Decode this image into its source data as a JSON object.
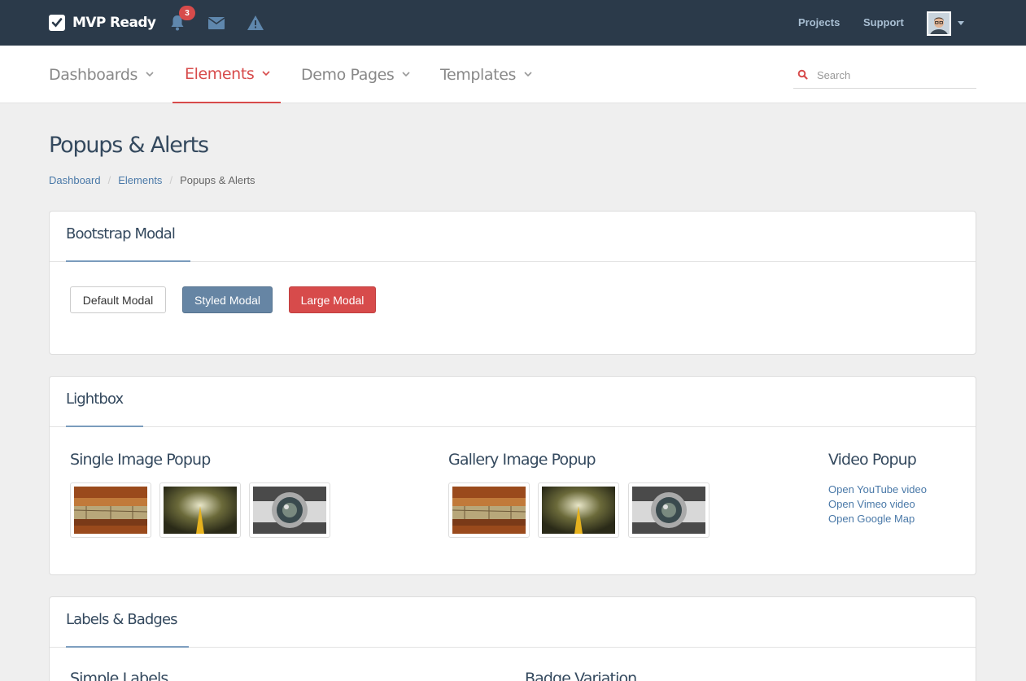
{
  "app": {
    "brand": "MVP Ready",
    "notification_count": "3",
    "top_links": {
      "projects": "Projects",
      "support": "Support"
    }
  },
  "nav": {
    "items": [
      {
        "label": "Dashboards",
        "active": false
      },
      {
        "label": "Elements",
        "active": true
      },
      {
        "label": "Demo Pages",
        "active": false
      },
      {
        "label": "Templates",
        "active": false
      }
    ],
    "search_placeholder": "Search"
  },
  "page": {
    "title": "Popups & Alerts",
    "breadcrumb": [
      "Dashboard",
      "Elements",
      "Popups & Alerts"
    ]
  },
  "modal_section": {
    "title": "Bootstrap Modal",
    "buttons": {
      "default": "Default Modal",
      "styled": "Styled Modal",
      "large": "Large Modal"
    }
  },
  "lightbox": {
    "title": "Lightbox",
    "single_title": "Single Image Popup",
    "gallery_title": "Gallery Image Popup",
    "video_title": "Video Popup",
    "video_links": [
      "Open YouTube video",
      "Open Vimeo video",
      "Open Google Map"
    ],
    "thumb_images": [
      "brick-wall-photo",
      "highway-motion-photo",
      "camera-lens-photo"
    ]
  },
  "labels_section": {
    "title": "Labels & Badges",
    "col_titles": [
      "Simple Labels",
      "Badge Variation"
    ]
  },
  "colors": {
    "topbar": "#2b3a4a",
    "accent_red": "#d74b4b",
    "link_blue": "#4a79a8",
    "heading": "#34495e"
  }
}
